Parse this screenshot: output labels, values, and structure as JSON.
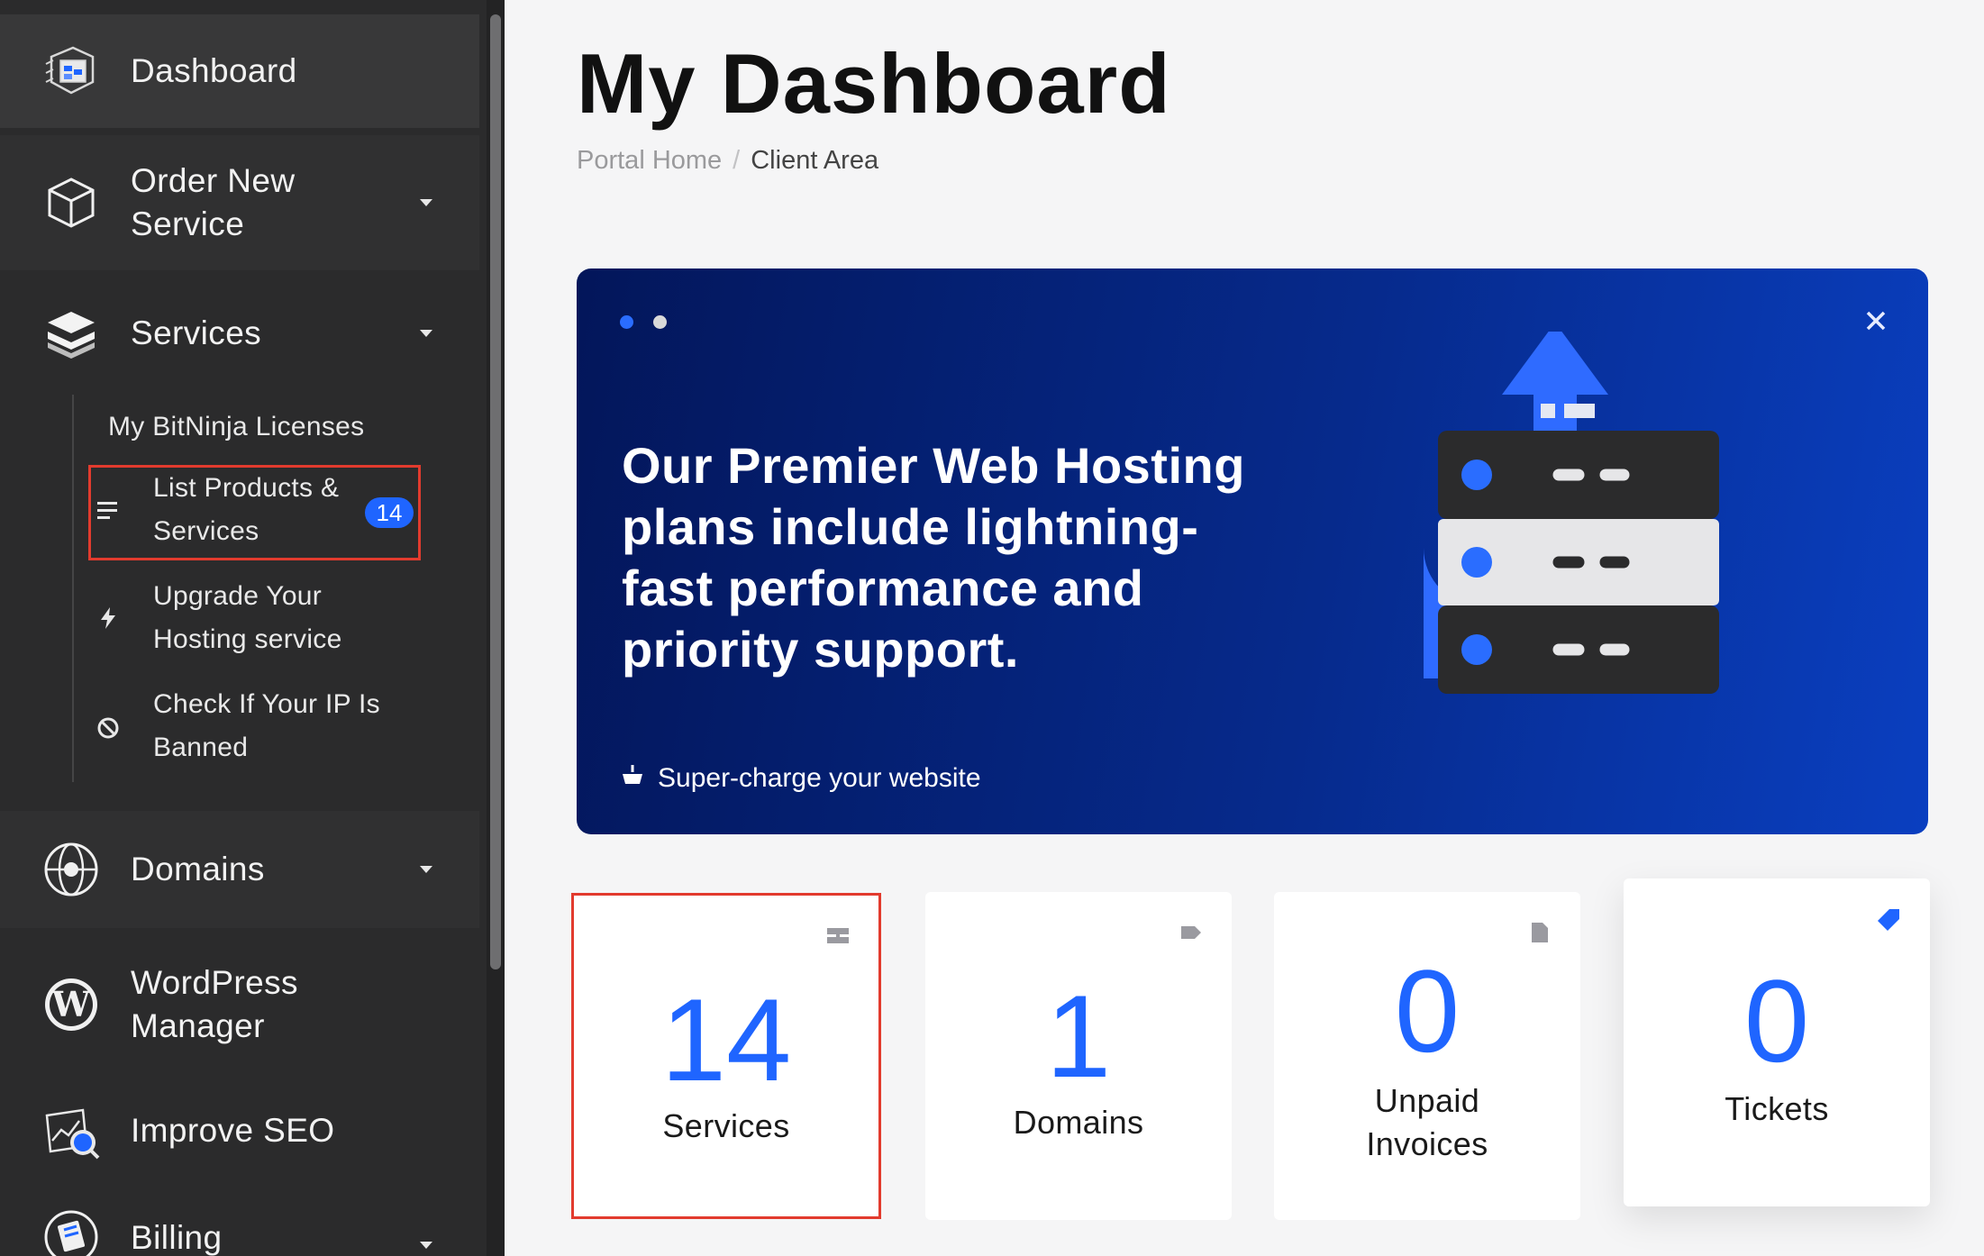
{
  "sidebar": {
    "dashboard": {
      "label": "Dashboard",
      "icon": "dashboard-icon"
    },
    "order": {
      "label": "Order New Service",
      "icon": "cube-icon"
    },
    "services": {
      "label": "Services",
      "icon": "layers-icon",
      "sub": {
        "licenses": "My BitNinja Licenses",
        "list": "List Products & Services",
        "list_badge": "14",
        "upgrade": "Upgrade Your Hosting service",
        "banned": "Check If Your IP Is Banned"
      }
    },
    "domains": {
      "label": "Domains",
      "icon": "globe-icon"
    },
    "wordpress": {
      "label": "WordPress Manager",
      "icon": "wordpress-icon"
    },
    "seo": {
      "label": "Improve SEO",
      "icon": "seo-icon"
    },
    "billing": {
      "label": "Billing",
      "icon": "billing-icon"
    }
  },
  "header": {
    "title": "My Dashboard",
    "breadcrumb": {
      "home": "Portal Home",
      "separator": "/",
      "current": "Client Area"
    }
  },
  "banner": {
    "headline": "Our Premier Web Hosting plans include lightning-fast performance and priority support.",
    "cta": "Super-charge your website",
    "close_symbol": "✕"
  },
  "stats": {
    "services": {
      "value": "14",
      "label": "Services",
      "icon": "server-icon"
    },
    "domains": {
      "value": "1",
      "label": "Domains",
      "icon": "tag-icon"
    },
    "invoices": {
      "value": "0",
      "label": "Unpaid Invoices",
      "icon": "document-icon"
    },
    "tickets": {
      "value": "0",
      "label": "Tickets",
      "icon": "ticket-icon"
    }
  },
  "colors": {
    "accent": "#1f65ff",
    "sidebar_bg": "#2b2b2c",
    "highlight_border": "#e23b2e",
    "banner_dark": "#03165a",
    "banner_light": "#0a3fc0"
  }
}
